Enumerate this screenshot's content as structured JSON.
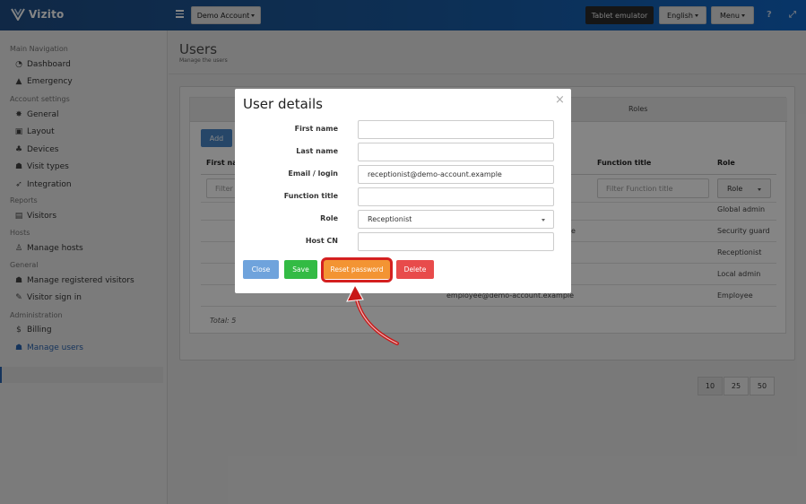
{
  "app": {
    "name": "Vizito",
    "account_button": "Demo Account",
    "tablet_emulator": "Tablet emulator",
    "language": "English",
    "menu": "Menu",
    "help_icon": "?",
    "expand_icon": "⤢"
  },
  "sidebar": {
    "sections": [
      {
        "heading": "Main Navigation",
        "items": [
          "Dashboard",
          "Emergency"
        ]
      },
      {
        "heading": "Account settings",
        "items": [
          "General",
          "Layout",
          "Devices",
          "Visit types",
          "Integration"
        ]
      },
      {
        "heading": "Reports",
        "items": [
          "Visitors"
        ]
      },
      {
        "heading": "Hosts",
        "items": [
          "Manage hosts"
        ]
      },
      {
        "heading": "General",
        "items": [
          "Manage registered visitors",
          "Visitor sign in"
        ]
      },
      {
        "heading": "Administration",
        "items": [
          "Billing",
          "Manage users"
        ]
      }
    ],
    "active": "Manage users"
  },
  "page": {
    "title": "Users",
    "subtitle": "Manage the users"
  },
  "table": {
    "group_header": "Roles",
    "add_button": "Add",
    "columns": [
      "First name",
      "Function title",
      "Role"
    ],
    "filters": {
      "first_name": "Filter F",
      "function_title": "Filter Function title",
      "role": "Role"
    },
    "rows": [
      {
        "email": "",
        "role": "Global admin"
      },
      {
        "email": "e",
        "role": "Security guard"
      },
      {
        "email": "",
        "role": "Receptionist"
      },
      {
        "email": "",
        "role": "Local admin"
      },
      {
        "email": "employee@demo-account.example",
        "role": "Employee"
      }
    ],
    "total": "Total: 5",
    "page_sizes": [
      "10",
      "25",
      "50"
    ],
    "page_size_selected": "10"
  },
  "modal": {
    "title": "User details",
    "close": "×",
    "fields": [
      {
        "label": "First name",
        "value": ""
      },
      {
        "label": "Last name",
        "value": ""
      },
      {
        "label": "Email / login",
        "value": "receptionist@demo-account.example"
      },
      {
        "label": "Function title",
        "value": ""
      },
      {
        "label": "Role",
        "value": "Receptionist"
      },
      {
        "label": "Host CN",
        "value": ""
      }
    ],
    "buttons": {
      "close": "Close",
      "save": "Save",
      "reset_password": "Reset password",
      "delete": "Delete"
    }
  },
  "colors": {
    "brand": "#1a5aa0",
    "close_btn": "#6fa3dc",
    "save_btn": "#33bb44",
    "reset_btn": "#f39433",
    "delete_btn": "#e84b4b",
    "highlight": "#d42020"
  },
  "icons": {
    "logo": "vizito-logo-icon",
    "hamburger": "menu-icon"
  }
}
